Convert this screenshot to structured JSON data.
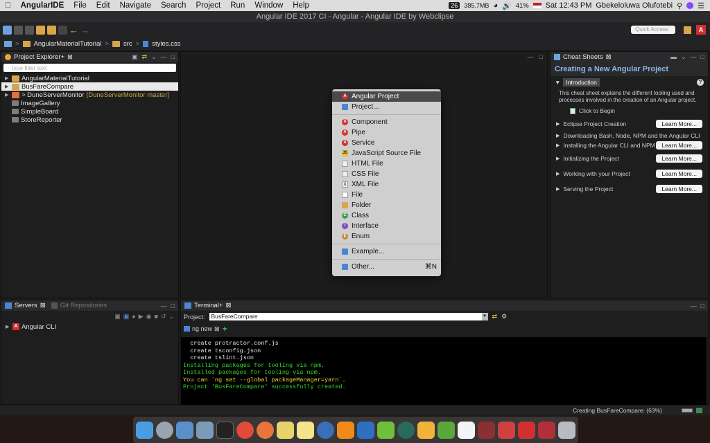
{
  "macbar": {
    "app_name": "AngularIDE",
    "menus": [
      "File",
      "Edit",
      "Navigate",
      "Search",
      "Project",
      "Run",
      "Window",
      "Help"
    ],
    "calendar_badge": "26",
    "network_speed": "385.7MB",
    "battery": "41%",
    "clock": "Sat 12:43 PM",
    "user": "Gbekeloluwa Olufotebi"
  },
  "window_title": "Angular IDE 2017 CI - Angular - Angular IDE by Webclipse",
  "toolbar": {
    "quick_access_placeholder": "Quick Access"
  },
  "breadcrumb": [
    "AngularMaterialTutorial",
    "src",
    "styles.css"
  ],
  "project_explorer": {
    "title": "Project Explorer+",
    "filter_placeholder": "type filter text",
    "items": [
      {
        "label": "AngularMaterialTutorial",
        "decorator": ""
      },
      {
        "label": "BusFareCompare",
        "decorator": ""
      },
      {
        "label": "> DuneServerMonitor",
        "decorator": "[DuneServerMonitor master]"
      },
      {
        "label": "ImageGallery",
        "decorator": ""
      },
      {
        "label": "SimpleBoard",
        "decorator": ""
      },
      {
        "label": "StoreReporter",
        "decorator": ""
      }
    ]
  },
  "context_menu": {
    "items": [
      {
        "label": "Angular Project",
        "icon": "angular-icon",
        "selected": true
      },
      {
        "label": "Project...",
        "icon": "project-icon"
      },
      {
        "label": "Component",
        "icon": "angular-icon"
      },
      {
        "label": "Pipe",
        "icon": "angular-icon"
      },
      {
        "label": "Service",
        "icon": "angular-icon"
      },
      {
        "label": "JavaScript Source File",
        "icon": "js-file-icon"
      },
      {
        "label": "HTML File",
        "icon": "html-file-icon"
      },
      {
        "label": "CSS File",
        "icon": "css-file-icon"
      },
      {
        "label": "XML File",
        "icon": "xml-file-icon"
      },
      {
        "label": "File",
        "icon": "file-icon"
      },
      {
        "label": "Folder",
        "icon": "folder-icon"
      },
      {
        "label": "Class",
        "icon": "class-icon"
      },
      {
        "label": "Interface",
        "icon": "interface-icon"
      },
      {
        "label": "Enum",
        "icon": "enum-icon"
      },
      {
        "label": "Example...",
        "icon": "example-icon"
      },
      {
        "label": "Other...",
        "icon": "other-icon",
        "shortcut": "⌘N"
      }
    ]
  },
  "cheat_sheets": {
    "tab": "Cheat Sheets",
    "title": "Creating a New Angular Project",
    "intro_heading": "Introduction",
    "intro_text": "This cheat sheet explains the different tooling used and processes involved in the creation of an Angular project.",
    "click_to_begin": "Click to Begin",
    "learn_more": "Learn More...",
    "steps": [
      "Eclipse Project Creation",
      "Downloading Bash, Node, NPM and the Angular CLI",
      "Installing the Angular CLI and NPM",
      "Initializing the Project",
      "Working with your Project",
      "Serving the Project"
    ]
  },
  "servers": {
    "tab": "Servers",
    "tab2": "Git Repositories",
    "items": [
      "Angular CLI"
    ]
  },
  "terminal": {
    "tab": "Terminal+",
    "project_label": "Project:",
    "project_value": "BusFareCompare",
    "session_tab": "ng new",
    "lines": [
      {
        "text": "  create protractor.conf.js",
        "color": "w"
      },
      {
        "text": "  create tsconfig.json",
        "color": "w"
      },
      {
        "text": "  create tslint.json",
        "color": "w"
      },
      {
        "text": "Installing packages for tooling via npm.",
        "color": "g"
      },
      {
        "text": "Installed packages for tooling via npm.",
        "color": "g"
      },
      {
        "text": "You can `ng set --global packageManager=yarn`.",
        "color": "y"
      },
      {
        "text": "Project 'BusFareCompare' successfully created.",
        "color": "g"
      }
    ]
  },
  "status": {
    "progress_text": "Creating BusFareCompare: (63%)"
  },
  "colors": {
    "accent": "#8fb7e6",
    "selection": "#4a4a4d",
    "angular": "#d0302f"
  }
}
